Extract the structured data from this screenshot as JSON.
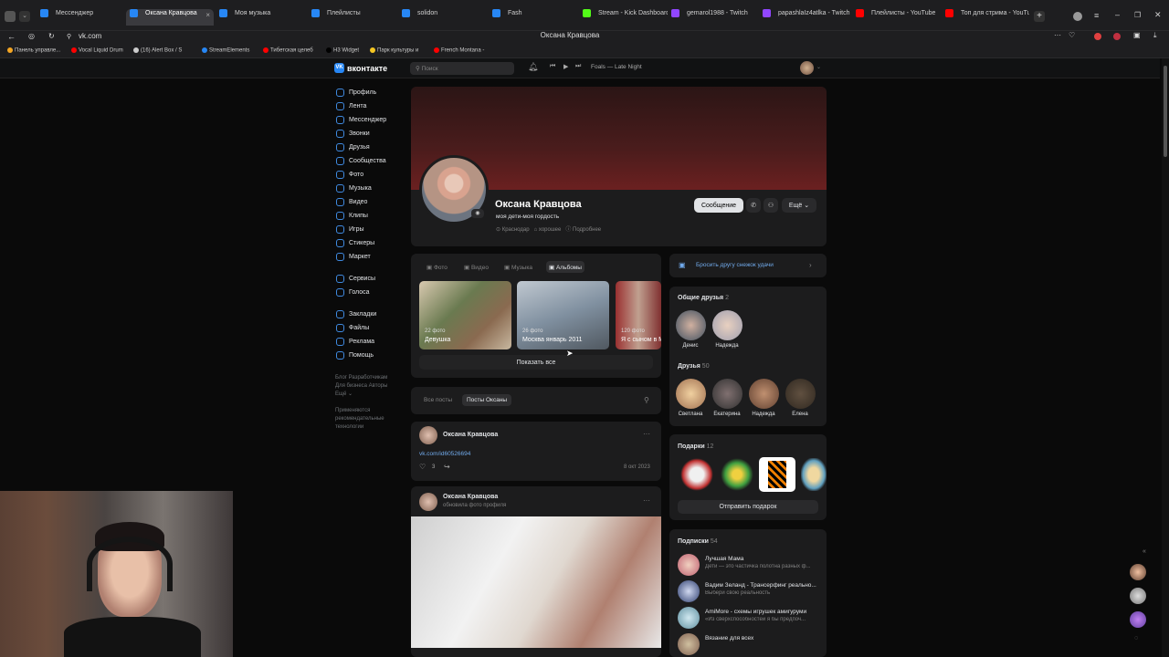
{
  "browser": {
    "tabs": [
      {
        "label": "",
        "color": "#aaaaaa"
      },
      {
        "label": "Мессенджер",
        "color": "#2787f5"
      },
      {
        "label": "Оксана Кравцова",
        "color": "#2787f5",
        "active": true
      },
      {
        "label": "Моя музыка",
        "color": "#2787f5"
      },
      {
        "label": "Плейлисты",
        "color": "#2787f5"
      },
      {
        "label": "solidon",
        "color": "#2787f5"
      },
      {
        "label": "Fash",
        "color": "#2787f5"
      },
      {
        "label": "Stream - Kick Dashboard",
        "color": "#53fc18"
      },
      {
        "label": "gemarol1988 - Twitch",
        "color": "#9146ff"
      },
      {
        "label": "papashlaIz4atlka - Twitch",
        "color": "#9146ff"
      },
      {
        "label": "Плейлисты - YouTube",
        "color": "#ff0000"
      },
      {
        "label": "Топ для стрима - YouTube",
        "color": "#ff0000"
      }
    ],
    "url": "vk.com",
    "page_title": "Оксана Кравцова",
    "bookmarks": [
      {
        "label": "Панель управле...",
        "color": "#f5a623"
      },
      {
        "label": "Vocal Liquid Drum",
        "color": "#ff0000"
      },
      {
        "label": "(16) Alert Box / S",
        "color": "#cccccc"
      },
      {
        "label": "StreamElements",
        "color": "#2787f5"
      },
      {
        "label": "Тибетская целеб",
        "color": "#ff0000"
      },
      {
        "label": "H3 Widget",
        "color": "#000000"
      },
      {
        "label": "Парк культуры и",
        "color": "#f5c623"
      },
      {
        "label": "French Montana -",
        "color": "#ff0000"
      }
    ]
  },
  "vk": {
    "logo": "вконтакте",
    "search_placeholder": "Поиск",
    "track": "Foals — Late Night",
    "menu": [
      "Профиль",
      "Лента",
      "Мессенджер",
      "Звонки",
      "Друзья",
      "Сообщества",
      "Фото",
      "Музыка",
      "Видео",
      "Клипы",
      "Игры",
      "Стикеры",
      "Маркет"
    ],
    "menu2": [
      "Сервисы",
      "Голоса"
    ],
    "menu3": [
      "Закладки",
      "Файлы",
      "Реклама",
      "Помощь"
    ],
    "footer": [
      "Блог  Разработчикам",
      "Для бизнеса  Авторы",
      "Ещё ⌄",
      "",
      "Применяются",
      "рекомендательные",
      "технологии"
    ]
  },
  "profile": {
    "name": "Оксана Кравцова",
    "status": "моя дети-моя гордость",
    "city": "Краснодар",
    "relation": "хорошее",
    "more": "Подробнее",
    "message_btn": "Сообщение",
    "more_btn": "Ещё"
  },
  "media": {
    "tabs": [
      "Фото",
      "Видео",
      "Музыка",
      "Альбомы"
    ],
    "albums": [
      {
        "count": "22 фото",
        "name": "Девушка",
        "bg": "linear-gradient(135deg,#d9c9b0,#6a7a50 40%,#8a6a50 70%,#c8b8a0)"
      },
      {
        "count": "26 фото",
        "name": "Москва январь 2011",
        "bg": "linear-gradient(160deg,#c0c8d0,#8090a0 50%,#505860)"
      },
      {
        "count": "120 фото",
        "name": "Я с сыном в М... жарким летом",
        "bg": "linear-gradient(90deg,#9a3030,#c0a090 50%,#803030)"
      }
    ],
    "show_all": "Показать все"
  },
  "posts": {
    "tabs": [
      "Все посты",
      "Посты Оксаны"
    ],
    "p1": {
      "author": "Оксана Кравцова",
      "link": "vk.com/id60526694",
      "likes": "3",
      "date": "8 окт 2023"
    },
    "p2": {
      "author": "Оксана Кравцова",
      "sub": "обновила фото профиля"
    }
  },
  "right": {
    "snowball": "Бросить другу снежок удачи",
    "mutual": {
      "title": "Общие друзья",
      "count": "2",
      "people": [
        "Денис",
        "Надежда"
      ]
    },
    "friends": {
      "title": "Друзья",
      "count": "50",
      "people": [
        "Светлана",
        "Екатерина",
        "Надежда",
        "Елена"
      ]
    },
    "gifts": {
      "title": "Подарки",
      "count": "12",
      "button": "Отправить подарок"
    },
    "subs": {
      "title": "Подписки",
      "count": "54",
      "items": [
        {
          "name": "Лучшая Мама",
          "desc": "Дети — это частичка полотна разных ф..."
        },
        {
          "name": "Вадим Зеланд - Трансерфинг реально...",
          "desc": "Выбери свою реальность"
        },
        {
          "name": "AmiMore - схемы игрушек амигуруми",
          "desc": "«Из сверхспособностей я бы предпоч..."
        },
        {
          "name": "Вязание для всех",
          "desc": ""
        }
      ]
    }
  }
}
